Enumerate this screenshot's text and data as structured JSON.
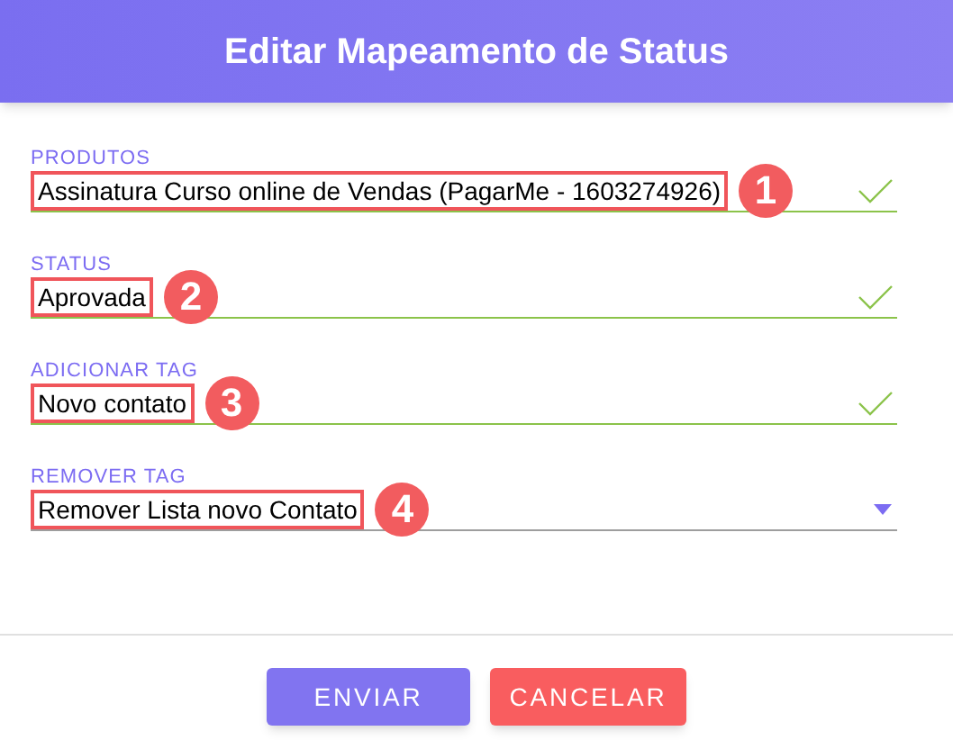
{
  "dialog": {
    "title": "Editar Mapeamento de Status"
  },
  "fields": [
    {
      "label": "PRODUTOS",
      "value": "Assinatura Curso online de Vendas (PagarMe - 1603274926)",
      "kind": "valid",
      "marker": "1"
    },
    {
      "label": "STATUS",
      "value": "Aprovada",
      "kind": "valid",
      "marker": "2"
    },
    {
      "label": "ADICIONAR TAG",
      "value": "Novo contato",
      "kind": "valid",
      "marker": "3"
    },
    {
      "label": "REMOVER TAG",
      "value": "Remover Lista novo Contato",
      "kind": "select",
      "marker": "4"
    }
  ],
  "buttons": [
    {
      "label": "ENVIAR",
      "kind": "primary"
    },
    {
      "label": "CANCELAR",
      "kind": "danger"
    }
  ]
}
